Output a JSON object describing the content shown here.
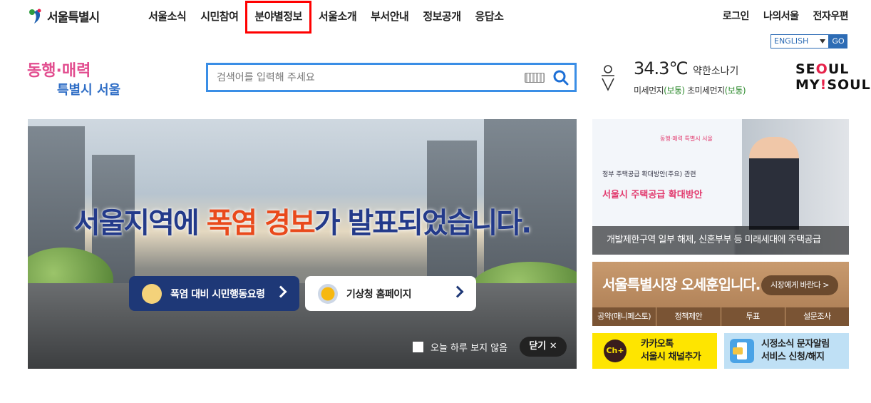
{
  "header": {
    "logo_text": "서울특별시",
    "nav": [
      {
        "label": "서울소식"
      },
      {
        "label": "시민참여"
      },
      {
        "label": "분야별정보",
        "highlighted": true
      },
      {
        "label": "서울소개"
      },
      {
        "label": "부서안내"
      },
      {
        "label": "정보공개"
      },
      {
        "label": "응답소"
      }
    ],
    "util": [
      "로그인",
      "나의서울",
      "전자우편"
    ],
    "language": {
      "selected": "ENGLISH",
      "go_label": "GO"
    }
  },
  "slogan": {
    "line1": "동행·매력",
    "line2": "특별시 서울"
  },
  "search": {
    "placeholder": "검색어를 입력해 주세요",
    "value": ""
  },
  "weather": {
    "temperature": "34.3℃",
    "condition": "약한소나기",
    "fine_dust_label": "미세먼지",
    "fine_dust_value": "(보통)",
    "ultra_fine_dust_label": "초미세먼지",
    "ultra_fine_dust_value": "(보통)"
  },
  "brand": {
    "line1_a": "SE",
    "line1_b": "O",
    "line1_c": "UL",
    "line2_a": "MY",
    "line2_b": "!",
    "line2_c": "SOUL"
  },
  "hero": {
    "title_a": "서울지역에 ",
    "title_b": "폭염 경보",
    "title_c": "가 발표되었습니다.",
    "button1": "폭염 대비 시민행동요령",
    "button2": "기상청 홈페이지",
    "dont_show_today": "오늘 하루 보지 않음",
    "close": "닫기 ✕"
  },
  "news": {
    "screen_org": "동행·매력 특별시 서울",
    "screen_small": "정부 주택공급 확대방안(주요) 관련",
    "screen_big": "서울시 주택공급 확대방안",
    "caption": "개발제한구역 일부 해제, 신혼부부 등 미래세대에 주택공급"
  },
  "mayor": {
    "title": "서울특별시장 오세훈입니다.",
    "button": "시장에게 바란다 >",
    "tabs": [
      "공약(매니페스토)",
      "정책제안",
      "투표",
      "설문조사"
    ]
  },
  "kakao": {
    "icon_text": "Ch+",
    "line1": "카카오톡",
    "line2": "서울시 채널추가"
  },
  "sms": {
    "line1": "시정소식 문자알림",
    "line2": "서비스 신청/해지"
  },
  "colors": {
    "accent_blue": "#3a8ee6",
    "highlight_red": "#ff0000",
    "kakao_yellow": "#fee500",
    "navy": "#1e3877"
  }
}
